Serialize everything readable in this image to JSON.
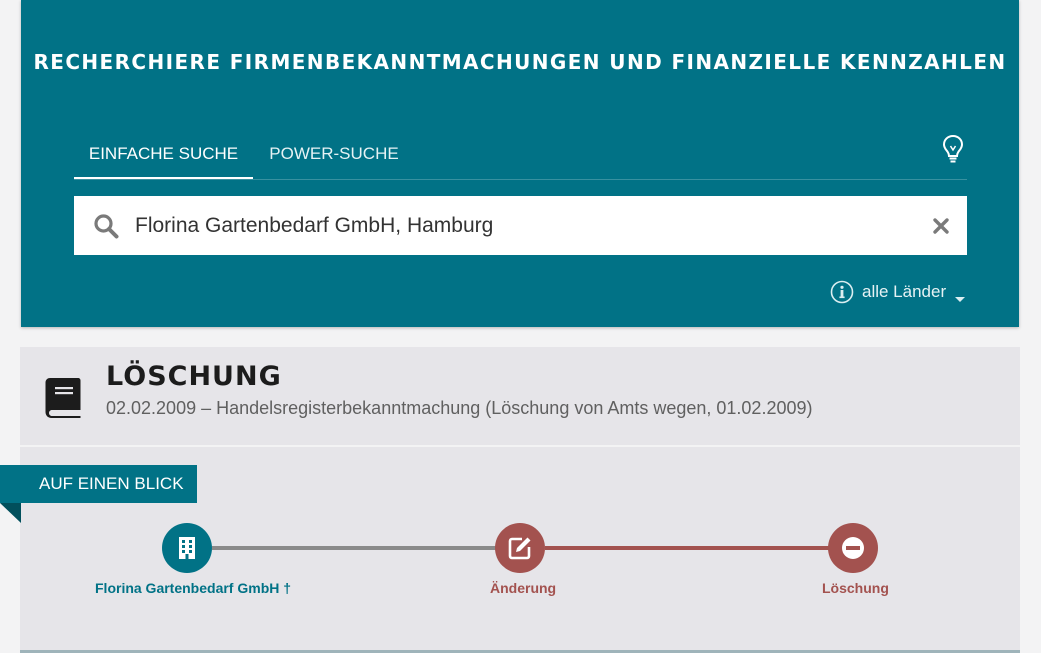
{
  "hero": {
    "title": "RECHERCHIERE FIRMENBEKANNTMACHUNGEN UND FINANZIELLE KENNZAHLEN",
    "tabs": [
      {
        "label": "EINFACHE SUCHE",
        "active": true
      },
      {
        "label": "POWER-SUCHE",
        "active": false
      }
    ],
    "search": {
      "value": "Florina Gartenbedarf GmbH, Hamburg",
      "placeholder": ""
    },
    "country_filter": "alle Länder"
  },
  "card": {
    "title": "LÖSCHUNG",
    "subtitle": "02.02.2009 – Handelsregisterbekanntmachung (Löschung von Amts wegen, 01.02.2009)",
    "ribbon": "AUF EINEN BLICK",
    "timeline": [
      {
        "label": "Florina Gartenbedarf GmbH †",
        "icon": "building-icon",
        "color": "#017286"
      },
      {
        "label": "Änderung",
        "icon": "edit-icon",
        "color": "#a3524f"
      },
      {
        "label": "Löschung",
        "icon": "minus-circle-icon",
        "color": "#a3524f"
      }
    ]
  },
  "colors": {
    "primary": "#017286",
    "accent_red": "#a3524f",
    "card_bg": "#e6e5e9",
    "page_bg": "#f3f3f4"
  }
}
